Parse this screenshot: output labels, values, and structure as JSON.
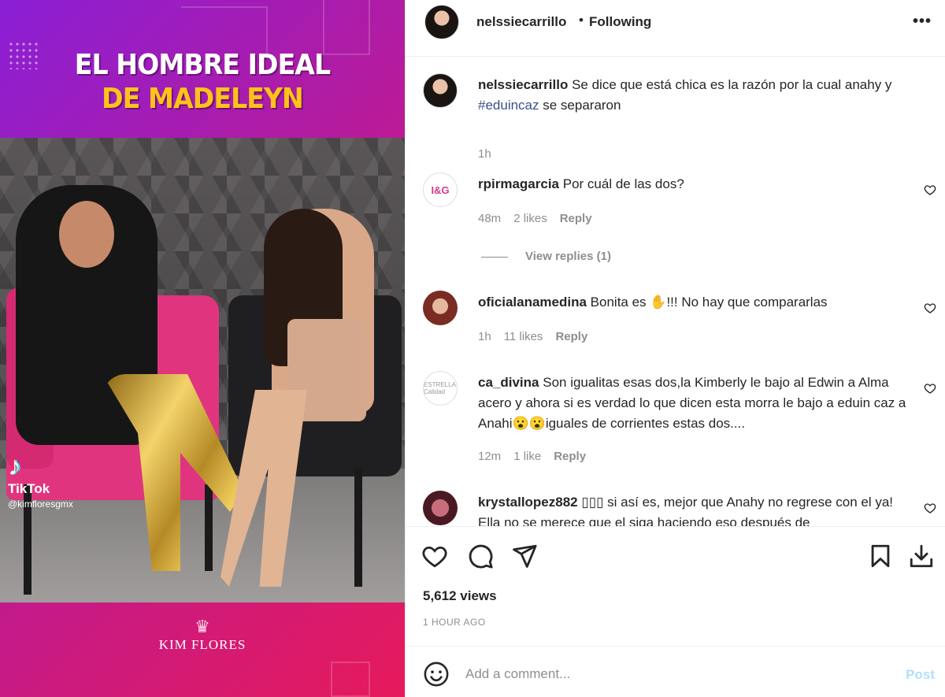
{
  "media": {
    "headline_line1": "EL HOMBRE IDEAL",
    "headline_line2": "DE MADELEYN",
    "tiktok_logo": "♪",
    "tiktok_label": "TikTok",
    "tiktok_handle": "@kimfloresgmx",
    "brand_name": "KIM FLORES",
    "brand_icon": "crown-icon",
    "colors": {
      "gradient_start": "#8a1fd6",
      "gradient_end": "#e61a5b",
      "headline_accent": "#ffc21a"
    }
  },
  "header": {
    "username": "nelssiecarrillo",
    "separator": "•",
    "follow_status": "Following",
    "more_icon": "more-options-icon"
  },
  "caption": {
    "username": "nelssiecarrillo",
    "text_before": "Se dice que está chica es la razón por la cual anahy y ",
    "hashtag": "#eduincaz",
    "text_after": " se separaron",
    "time": "1h"
  },
  "comments": [
    {
      "username": "rpirmagarcia",
      "avatar_text": "I&G",
      "text": "Por cuál de las dos?",
      "time": "48m",
      "likes": "2 likes",
      "reply": "Reply",
      "view_replies": "View replies (1)"
    },
    {
      "username": "oficialanamedina",
      "text": "Bonita es ✋!!! No hay que compararlas",
      "time": "1h",
      "likes": "11 likes",
      "reply": "Reply"
    },
    {
      "username": "ca_divina",
      "avatar_text": "ESTRELLA Calidad",
      "text": "Son igualitas esas dos,la Kimberly le bajo al Edwin a Alma acero y ahora si es verdad lo que dicen esta morra le bajo a eduin caz a Anahi😮😮iguales de corrientes estas dos....",
      "time": "12m",
      "likes": "1 like",
      "reply": "Reply"
    },
    {
      "username": "krystallopez882",
      "text": "▯▯▯ si así es, mejor que Anahy no regrese con el ya! Ella no se merece que el siga haciendo eso después de",
      "time": "",
      "likes": "",
      "reply": ""
    }
  ],
  "actions": {
    "views": "5,612 views",
    "posted": "1 HOUR AGO"
  },
  "add_comment": {
    "placeholder": "Add a comment...",
    "post_label": "Post",
    "post_color": "#b2dffc"
  }
}
